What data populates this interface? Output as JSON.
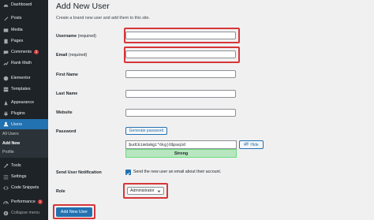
{
  "sidebar": {
    "items": [
      {
        "label": "Dashboard",
        "icon": "dashboard-icon"
      },
      {
        "label": "Posts",
        "icon": "posts-icon"
      },
      {
        "label": "Media",
        "icon": "media-icon"
      },
      {
        "label": "Pages",
        "icon": "pages-icon"
      },
      {
        "label": "Comments",
        "icon": "comments-icon",
        "badge": "2"
      },
      {
        "label": "Rank Math",
        "icon": "rank-math-icon"
      },
      {
        "label": "Elementor",
        "icon": "elementor-icon"
      },
      {
        "label": "Templates",
        "icon": "templates-icon"
      },
      {
        "label": "Appearance",
        "icon": "appearance-icon"
      },
      {
        "label": "Plugins",
        "icon": "plugins-icon"
      },
      {
        "label": "Users",
        "icon": "users-icon"
      },
      {
        "label": "Tools",
        "icon": "tools-icon"
      },
      {
        "label": "Settings",
        "icon": "settings-icon"
      },
      {
        "label": "Code Snippets",
        "icon": "code-snippets-icon"
      },
      {
        "label": "Performance",
        "icon": "performance-icon",
        "badge": "1"
      },
      {
        "label": "Collapse menu",
        "icon": "collapse-icon"
      }
    ],
    "users_submenu": [
      "All Users",
      "Add New",
      "Profile"
    ]
  },
  "page": {
    "title": "Add New User",
    "description": "Create a brand new user and add them to this site."
  },
  "form": {
    "username_label": "Username",
    "username_req": "(required)",
    "username_value": "",
    "email_label": "Email",
    "email_req": "(required)",
    "email_value": "",
    "first_name_label": "First Name",
    "first_name_value": "",
    "last_name_label": "Last Name",
    "last_name_value": "",
    "website_label": "Website",
    "website_value": "",
    "password_label": "Password",
    "generate_password_label": "Generate password",
    "password_value": "$udCE1mdaNg1*6kg)O$paq3d",
    "hide_label": "Hide",
    "strength_label": "Strong",
    "notification_label": "Send User Notification",
    "notification_text": "Send the new user an email about their account.",
    "role_label": "Role",
    "role_value": "Administrator",
    "submit_label": "Add New User"
  },
  "colors": {
    "sidebar_bg": "#1d2327",
    "accent": "#2271b1",
    "highlight": "#d63638",
    "strong_bg": "#b8e6bf"
  }
}
